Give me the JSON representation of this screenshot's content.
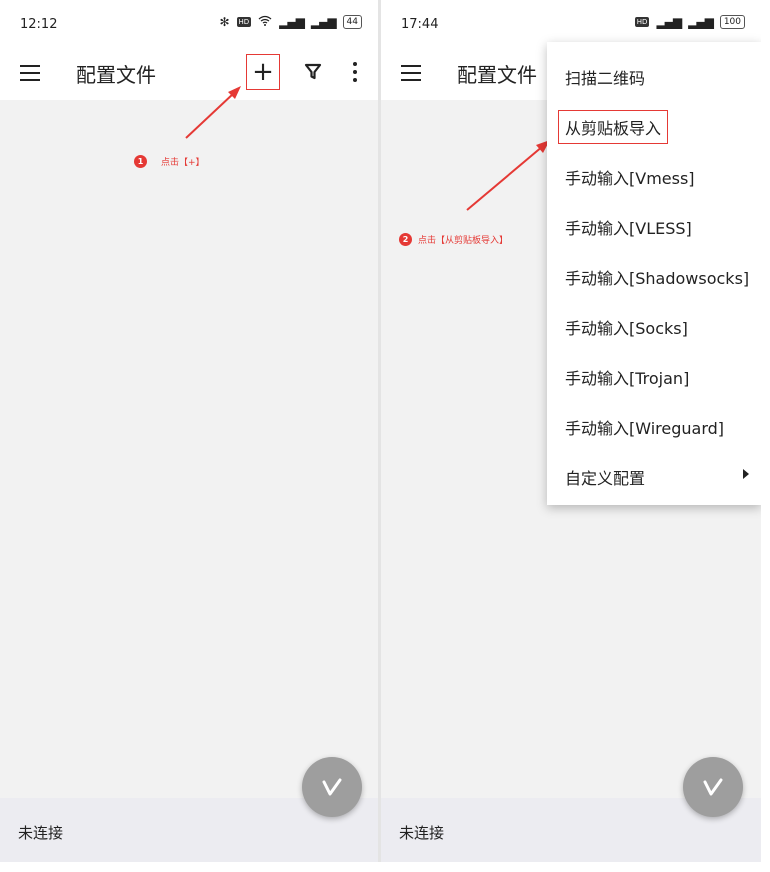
{
  "left": {
    "status_time": "12:12",
    "battery": "44",
    "title": "配置文件",
    "annotation_num": "1",
    "annotation_text": "点击【+】",
    "bottom_status": "未连接"
  },
  "right": {
    "status_time": "17:44",
    "battery": "100",
    "title": "配置文件",
    "annotation_num": "2",
    "annotation_text": "点击【从剪贴板导入】",
    "bottom_status": "未连接",
    "menu_items": [
      {
        "label": "扫描二维码"
      },
      {
        "label": "从剪贴板导入"
      },
      {
        "label": "手动输入[Vmess]"
      },
      {
        "label": "手动输入[VLESS]"
      },
      {
        "label": "手动输入[Shadowsocks]"
      },
      {
        "label": "手动输入[Socks]"
      },
      {
        "label": "手动输入[Trojan]"
      },
      {
        "label": "手动输入[Wireguard]"
      },
      {
        "label": "自定义配置"
      }
    ]
  },
  "icons": {
    "menu": "hamburger-menu-icon",
    "add": "plus-icon",
    "filter": "filter-icon",
    "more": "more-vertical-icon",
    "fab": "v-logo-icon",
    "submenu": "caret-right-icon"
  },
  "colors": {
    "annotation_red": "#e53935",
    "fab_gray": "#9e9e9e",
    "background": "#f2f2f2",
    "bottom_bar": "#ececf1"
  }
}
